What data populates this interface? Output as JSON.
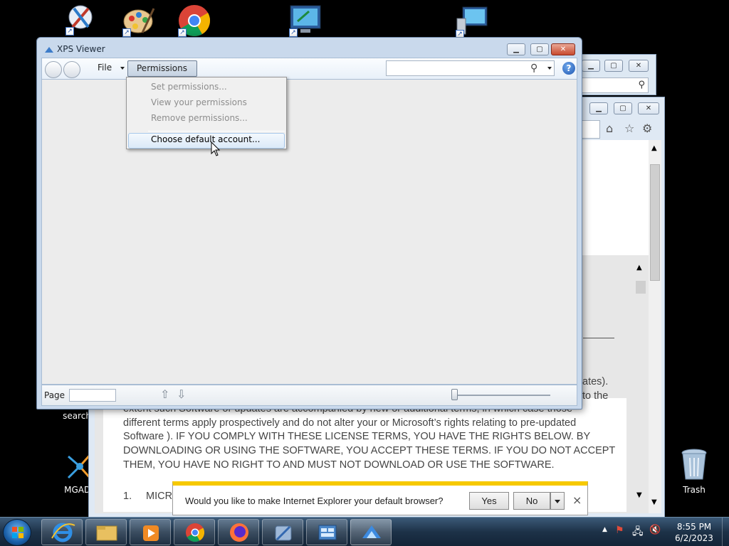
{
  "desktop": {
    "icons": [
      {
        "name": "paint-icon"
      },
      {
        "name": "palette-icon"
      },
      {
        "name": "chrome-icon"
      },
      {
        "name": "computer-icon"
      },
      {
        "name": "network-computer-icon"
      },
      {
        "name": "search-icon",
        "label": "search"
      },
      {
        "name": "mgadiag-icon",
        "label": "MGADia"
      },
      {
        "name": "trash-icon",
        "label": "Trash"
      }
    ]
  },
  "ie_window": {
    "text_fragments": {
      "dates": "ates).",
      "to_the": "to the",
      "license_lines": [
        "extent such Software or updates are accompanied by new or additional terms, in which case those",
        "different terms apply prospectively and do not alter your or Microsoft’s rights relating to pre-updated",
        "Software ). IF YOU COMPLY WITH THESE LICENSE TERMS, YOU HAVE THE RIGHTS BELOW. BY",
        "DOWNLOADING OR USING THE SOFTWARE, YOU ACCEPT THESE TERMS. IF YOU DO NOT ACCEPT",
        "THEM, YOU HAVE NO RIGHT TO AND MUST NOT DOWNLOAD OR USE THE SOFTWARE."
      ],
      "item_number": "1.",
      "item_text": "MICR"
    }
  },
  "xps_viewer": {
    "title": "XPS Viewer",
    "toolbar": {
      "file_label": "File",
      "permissions_label": "Permissions",
      "search_placeholder": ""
    },
    "menu": {
      "items": [
        {
          "label": "Set permissions...",
          "enabled": false
        },
        {
          "label": "View your permissions",
          "enabled": false
        },
        {
          "label": "Remove permissions...",
          "enabled": false
        },
        {
          "label": "Choose default account...",
          "enabled": true
        }
      ]
    },
    "status": {
      "page_label": "Page",
      "page_value": ""
    }
  },
  "ie_default_bar": {
    "question": "Would you like to make Internet Explorer your default browser?",
    "yes_label": "Yes",
    "no_label": "No",
    "close_glyph": "×"
  },
  "taskbar": {
    "items": [
      "internet-explorer",
      "file-explorer",
      "media-player",
      "chrome",
      "firefox",
      "utility",
      "control-panel",
      "xps-viewer"
    ],
    "clock": {
      "time": "8:55 PM",
      "date": "6/2/2023"
    }
  },
  "colors": {
    "accent_bar": "#f6c900",
    "window_frame": "#c9d9ec",
    "close_button": "#c84a2e"
  }
}
